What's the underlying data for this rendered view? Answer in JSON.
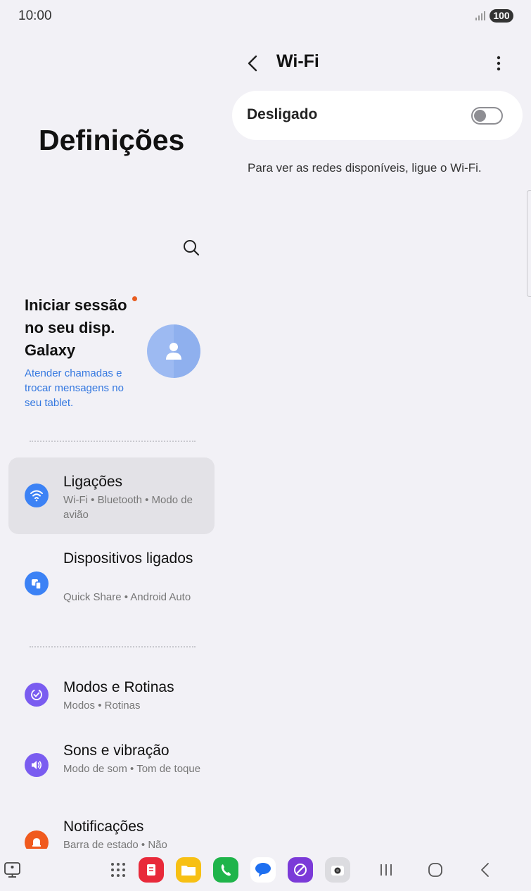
{
  "status": {
    "time": "10:00",
    "battery": "100"
  },
  "left": {
    "title": "Definições",
    "account": {
      "title": "Iniciar sessão no seu disp. Galaxy",
      "subtitle": "Atender chamadas e trocar mensagens no seu tablet."
    },
    "items": [
      {
        "title": "Ligações",
        "subtitle": "Wi-Fi • Bluetooth • Modo de avião",
        "icon": "wifi-icon",
        "color": "#3c82f5"
      },
      {
        "title": "Dispositivos ligados",
        "subtitle": "Quick Share • Android Auto",
        "icon": "devices-icon",
        "color": "#3c82f5"
      },
      {
        "title": "Modos e Rotinas",
        "subtitle": "Modos • Rotinas",
        "icon": "modes-icon",
        "color": "#7a5cf0"
      },
      {
        "title": "Sons e vibração",
        "subtitle": "Modo de som • Tom de toque",
        "icon": "sound-icon",
        "color": "#7a5cf0"
      },
      {
        "title": "Notificações",
        "subtitle": "Barra de estado • Não",
        "icon": "bell-icon",
        "color": "#f05a1e"
      }
    ]
  },
  "right": {
    "title": "Wi-Fi",
    "toggle_label": "Desligado",
    "toggle_on": false,
    "info": "Para ver as redes disponíveis, ligue o Wi-Fi."
  },
  "dock": {
    "apps": [
      "notes-app-icon",
      "files-app-icon",
      "phone-app-icon",
      "messages-app-icon",
      "galaxy-store-icon",
      "camera-app-icon"
    ]
  }
}
